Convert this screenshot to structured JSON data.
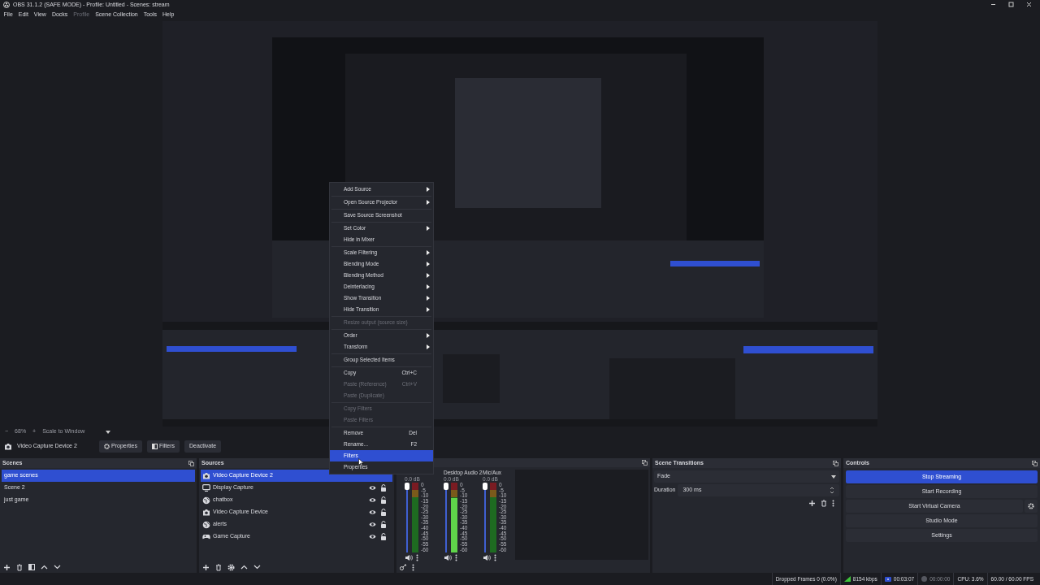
{
  "window": {
    "title": "OBS 31.1.2 (SAFE MODE) - Profile: Untitled - Scenes: stream"
  },
  "menu_bar": [
    {
      "label": "File",
      "disabled": false
    },
    {
      "label": "Edit",
      "disabled": false
    },
    {
      "label": "View",
      "disabled": false
    },
    {
      "label": "Docks",
      "disabled": false
    },
    {
      "label": "Profile",
      "disabled": true
    },
    {
      "label": "Scene Collection",
      "disabled": false
    },
    {
      "label": "Tools",
      "disabled": false
    },
    {
      "label": "Help",
      "disabled": false
    }
  ],
  "zoom_bar": {
    "minus": "−",
    "zoom": "68%",
    "plus": "+",
    "scale": "Scale to Window"
  },
  "source_toolbar": {
    "source": "Video Capture Device 2",
    "buttons": [
      {
        "label": "Properties",
        "kind": "gear"
      },
      {
        "label": "Filters",
        "kind": "filter"
      },
      {
        "label": "Deactivate",
        "kind": "plain"
      }
    ]
  },
  "scenes": {
    "title": "Scenes",
    "items": [
      {
        "label": "game scenes",
        "selected": true
      },
      {
        "label": "Scene 2",
        "selected": false
      },
      {
        "label": "just game",
        "selected": false
      }
    ]
  },
  "sources": {
    "title": "Sources",
    "items": [
      {
        "label": "Video Capture Device 2",
        "kind": "camera",
        "selected": true,
        "icons_shown": false
      },
      {
        "label": "Display Capture",
        "kind": "display",
        "selected": false,
        "icons_shown": true
      },
      {
        "label": "chatbox",
        "kind": "browser",
        "selected": false,
        "icons_shown": true
      },
      {
        "label": "Video Capture Device",
        "kind": "camera",
        "selected": false,
        "icons_shown": true
      },
      {
        "label": "alerts",
        "kind": "browser",
        "selected": false,
        "icons_shown": true
      },
      {
        "label": "Game Capture",
        "kind": "game",
        "selected": false,
        "icons_shown": true
      }
    ]
  },
  "audio_mixer": {
    "channels": [
      {
        "reading": "0.0 dB",
        "level": 1,
        "scale": [
          "0",
          "-5",
          "-10",
          "-15",
          "-20",
          "-25",
          "-30",
          "-35",
          "-40",
          "-45",
          "-50",
          "-55",
          "-60"
        ]
      },
      {
        "name": "Desktop Audio 2",
        "reading": "0.0 dB",
        "level": 1,
        "meter": {
          "level": 0.78
        },
        "scale": [
          "0",
          "-5",
          "-10",
          "-15",
          "-20",
          "-25",
          "-30",
          "-35",
          "-40",
          "-45",
          "-50",
          "-55",
          "-60"
        ]
      },
      {
        "name": "Mic/Aux",
        "reading": "0.0 dB",
        "level": 1,
        "scale": [
          "0",
          "-5",
          "-10",
          "-15",
          "-20",
          "-25",
          "-30",
          "-35",
          "-40",
          "-45",
          "-50",
          "-55",
          "-60"
        ]
      }
    ]
  },
  "scene_transitions": {
    "title": "Scene Transitions",
    "transition": "Fade",
    "duration_label": "Duration",
    "duration": "300 ms"
  },
  "controls": {
    "title": "Controls",
    "buttons": [
      {
        "label": "Stop Streaming",
        "active": true,
        "settings_button": false
      },
      {
        "label": "Start Recording",
        "active": false,
        "settings_button": false
      },
      {
        "label": "Start Virtual Camera",
        "active": false,
        "settings_button": true
      },
      {
        "label": "Studio Mode",
        "active": false,
        "settings_button": false
      },
      {
        "label": "Settings",
        "active": false,
        "settings_button": false
      }
    ]
  },
  "status_bar": {
    "dropped_frames": "Dropped Frames 0 (0.0%)",
    "bitrate": "8154 kbps",
    "stream_time": "00:03:07",
    "recording": false,
    "record_time": "00:00:00",
    "cpu": "CPU: 3.6%",
    "fps": "60.00 / 60.00 FPS"
  },
  "context_menu": {
    "items": [
      {
        "kind": "item",
        "label": "Add Source",
        "submenu": true,
        "disabled": false,
        "selected": false
      },
      {
        "kind": "separator"
      },
      {
        "kind": "item",
        "label": "Open Source Projector",
        "submenu": true,
        "disabled": false,
        "selected": false
      },
      {
        "kind": "separator"
      },
      {
        "kind": "item",
        "label": "Save Source Screenshot",
        "submenu": false,
        "disabled": false,
        "selected": false
      },
      {
        "kind": "separator"
      },
      {
        "kind": "item",
        "label": "Set Color",
        "submenu": true,
        "disabled": false,
        "selected": false
      },
      {
        "kind": "item",
        "label": "Hide in Mixer",
        "submenu": false,
        "disabled": false,
        "selected": false
      },
      {
        "kind": "separator"
      },
      {
        "kind": "item",
        "label": "Scale Filtering",
        "submenu": true,
        "disabled": false,
        "selected": false
      },
      {
        "kind": "item",
        "label": "Blending Mode",
        "submenu": true,
        "disabled": false,
        "selected": false
      },
      {
        "kind": "item",
        "label": "Blending Method",
        "submenu": true,
        "disabled": false,
        "selected": false
      },
      {
        "kind": "item",
        "label": "Deinterlacing",
        "submenu": true,
        "disabled": false,
        "selected": false
      },
      {
        "kind": "item",
        "label": "Show Transition",
        "submenu": true,
        "disabled": false,
        "selected": false
      },
      {
        "kind": "item",
        "label": "Hide Transition",
        "submenu": true,
        "disabled": false,
        "selected": false
      },
      {
        "kind": "separator"
      },
      {
        "kind": "item",
        "label": "Resize output (source size)",
        "submenu": false,
        "disabled": true,
        "selected": false
      },
      {
        "kind": "separator"
      },
      {
        "kind": "item",
        "label": "Order",
        "submenu": true,
        "disabled": false,
        "selected": false
      },
      {
        "kind": "item",
        "label": "Transform",
        "submenu": true,
        "disabled": false,
        "selected": false
      },
      {
        "kind": "separator"
      },
      {
        "kind": "item",
        "label": "Group Selected Items",
        "submenu": false,
        "disabled": false,
        "selected": false
      },
      {
        "kind": "separator"
      },
      {
        "kind": "item",
        "label": "Copy",
        "shortcut": "Ctrl+C",
        "submenu": false,
        "disabled": false,
        "selected": false
      },
      {
        "kind": "item",
        "label": "Paste (Reference)",
        "shortcut": "Ctrl+V",
        "submenu": false,
        "disabled": true,
        "selected": false
      },
      {
        "kind": "item",
        "label": "Paste (Duplicate)",
        "submenu": false,
        "disabled": true,
        "selected": false
      },
      {
        "kind": "separator"
      },
      {
        "kind": "item",
        "label": "Copy Filters",
        "submenu": false,
        "disabled": true,
        "selected": false
      },
      {
        "kind": "item",
        "label": "Paste Filters",
        "submenu": false,
        "disabled": true,
        "selected": false
      },
      {
        "kind": "separator"
      },
      {
        "kind": "item",
        "label": "Remove",
        "shortcut": "Del",
        "submenu": false,
        "disabled": false,
        "selected": false
      },
      {
        "kind": "item",
        "label": "Rename...",
        "shortcut": "F2",
        "submenu": false,
        "disabled": false,
        "selected": false
      },
      {
        "kind": "item",
        "label": "Filters",
        "submenu": false,
        "disabled": false,
        "selected": true
      },
      {
        "kind": "item",
        "label": "Properties",
        "submenu": false,
        "disabled": false,
        "selected": false
      }
    ]
  }
}
